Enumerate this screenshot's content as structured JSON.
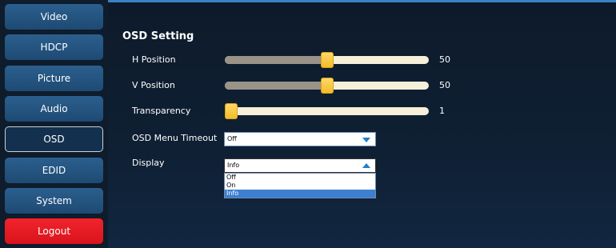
{
  "nav": {
    "items": [
      {
        "label": "Video"
      },
      {
        "label": "HDCP"
      },
      {
        "label": "Picture"
      },
      {
        "label": "Audio"
      },
      {
        "label": "OSD",
        "active": true
      },
      {
        "label": "EDID"
      },
      {
        "label": "System"
      }
    ],
    "logout_label": "Logout"
  },
  "osd": {
    "title": "OSD Setting",
    "h_position": {
      "label": "H Position",
      "value": "50",
      "min": 0,
      "max": 100
    },
    "v_position": {
      "label": "V Position",
      "value": "50",
      "min": 0,
      "max": 100
    },
    "transparency": {
      "label": "Transparency",
      "value": "1",
      "min": 1,
      "max": 100
    },
    "menu_timeout": {
      "label": "OSD Menu Timeout",
      "selected": "Off"
    },
    "display": {
      "label": "Display",
      "selected": "Info",
      "options": [
        "Off",
        "On",
        "Info"
      ]
    }
  },
  "colors": {
    "nav_button": "#2b5f8e",
    "logout_button": "#e81b23",
    "slider_thumb": "#f7c843",
    "dropdown_highlight": "#3d7fd0"
  }
}
